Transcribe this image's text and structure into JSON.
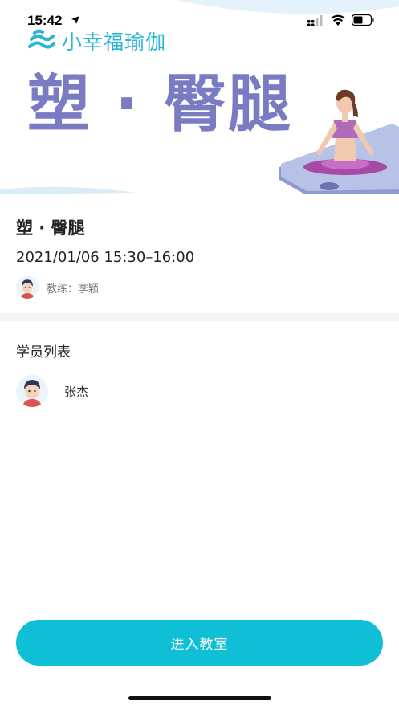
{
  "status_bar": {
    "time": "15:42",
    "icons": [
      "location-arrow-icon",
      "cellular-signal-icon",
      "wifi-icon",
      "battery-icon"
    ]
  },
  "banner": {
    "logo_text": "小幸福瑜伽",
    "title": "塑 · 臀腿",
    "colors": {
      "title": "#7a7cc3",
      "logo": "#2bb5d6"
    }
  },
  "course": {
    "name": "塑 · 臀腿",
    "datetime": "2021/01/06 15:30–16:00",
    "coach_label": "教练：李颖"
  },
  "students": {
    "title": "学员列表",
    "list": [
      {
        "name": "张杰"
      }
    ]
  },
  "actions": {
    "enter_classroom": "进入教室",
    "accent_color": "#0fbfd6"
  }
}
